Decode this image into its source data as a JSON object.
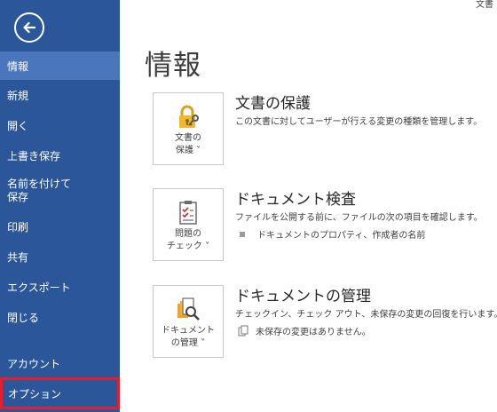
{
  "top_right_text": "文書",
  "sidebar": {
    "back_icon": "back-arrow-icon",
    "items": [
      {
        "label": "情報",
        "active": true
      },
      {
        "label": "新規"
      },
      {
        "label": "開く"
      },
      {
        "label": "上書き保存"
      },
      {
        "label": "名前を付けて\n保存"
      },
      {
        "label": "印刷"
      },
      {
        "label": "共有"
      },
      {
        "label": "エクスポート"
      },
      {
        "label": "閉じる"
      }
    ],
    "account_label": "アカウント",
    "options_label": "オプション"
  },
  "main": {
    "title": "情報",
    "sections": [
      {
        "tile_label": "文書の\n保護 ˅",
        "tile_icon": "lock-key-icon",
        "title": "文書の保護",
        "description": "この文書に対してユーザーが行える変更の種類を管理します。"
      },
      {
        "tile_label": "問題の\nチェック ˅",
        "tile_icon": "checklist-icon",
        "title": "ドキュメント検査",
        "description": "ファイルを公開する前に、ファイルの次の項目を確認します。",
        "sub": "ドキュメントのプロパティ、作成者の名前"
      },
      {
        "tile_label": "ドキュメント\nの管理 ˅",
        "tile_icon": "manage-documents-icon",
        "title": "ドキュメントの管理",
        "description": "チェックイン、チェック アウト、未保存の変更の回復を行います。",
        "sub": "未保存の変更はありません。"
      }
    ]
  },
  "colors": {
    "sidebar_bg": "#2b579a",
    "sidebar_active": "#4a76bd",
    "options_highlight": "#e61e2b"
  }
}
